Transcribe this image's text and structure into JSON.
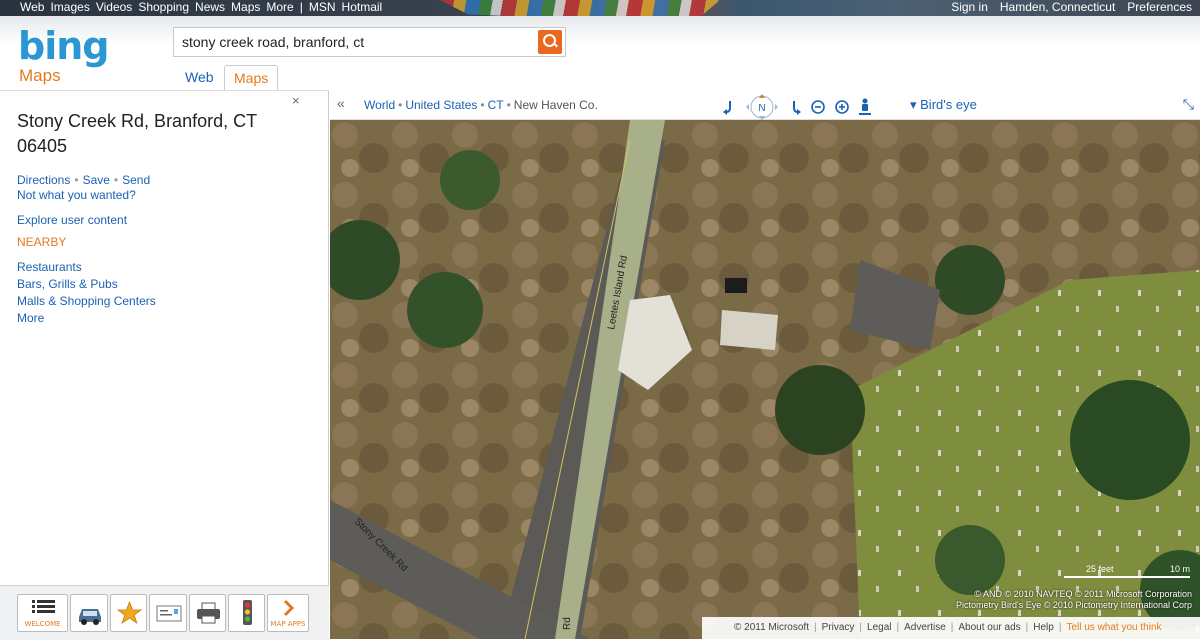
{
  "topnav": {
    "left": [
      "Web",
      "Images",
      "Videos",
      "Shopping",
      "News",
      "Maps",
      "More",
      "|",
      "MSN",
      "Hotmail"
    ],
    "right": [
      "Sign in",
      "Hamden, Connecticut",
      "Preferences"
    ]
  },
  "header": {
    "logo": "bing",
    "logo_sub": "Maps",
    "search_value": "stony creek road, branford, ct",
    "tabs": [
      "Web",
      "Maps"
    ]
  },
  "panel": {
    "close": "×",
    "title": "Stony Creek Rd, Branford, CT 06405",
    "actions": [
      "Directions",
      "Save",
      "Send"
    ],
    "not_what": "Not what you wanted?",
    "explore": "Explore user content",
    "nearby_heading": "NEARBY",
    "nearby": [
      "Restaurants",
      "Bars, Grills & Pubs",
      "Malls & Shopping Centers",
      "More"
    ],
    "toolbar": [
      {
        "icon": "list-icon",
        "caption": "WELCOME"
      },
      {
        "icon": "car-icon",
        "caption": ""
      },
      {
        "icon": "star-icon",
        "caption": ""
      },
      {
        "icon": "card-icon",
        "caption": ""
      },
      {
        "icon": "printer-icon",
        "caption": ""
      },
      {
        "icon": "traffic-light-icon",
        "caption": ""
      },
      {
        "icon": "chevron-right-icon",
        "caption": "MAP APPS"
      }
    ]
  },
  "mapbar": {
    "collapse": "«",
    "breadcrumbs": [
      "World",
      "United States",
      "CT",
      "New Haven Co."
    ],
    "view": "Bird's eye"
  },
  "map": {
    "roads": [
      "Leetes Island Rd",
      "Stony Creek Rd",
      "Rd"
    ],
    "scale_feet": "25 feet",
    "scale_m": "10 m",
    "copyright_line1": "© AND  © 2010 NAVTEQ  © 2011 Microsoft Corporation",
    "copyright_line2": "Pictometry Bird's Eye © 2010 Pictometry International Corp",
    "footer": [
      "© 2011 Microsoft",
      "Privacy",
      "Legal",
      "Advertise",
      "About our ads",
      "Help"
    ],
    "footer_tell": "Tell us what you think"
  },
  "colors": {
    "accent": "#e47a1f",
    "link": "#1a62b5",
    "logo": "#2a96d4"
  }
}
